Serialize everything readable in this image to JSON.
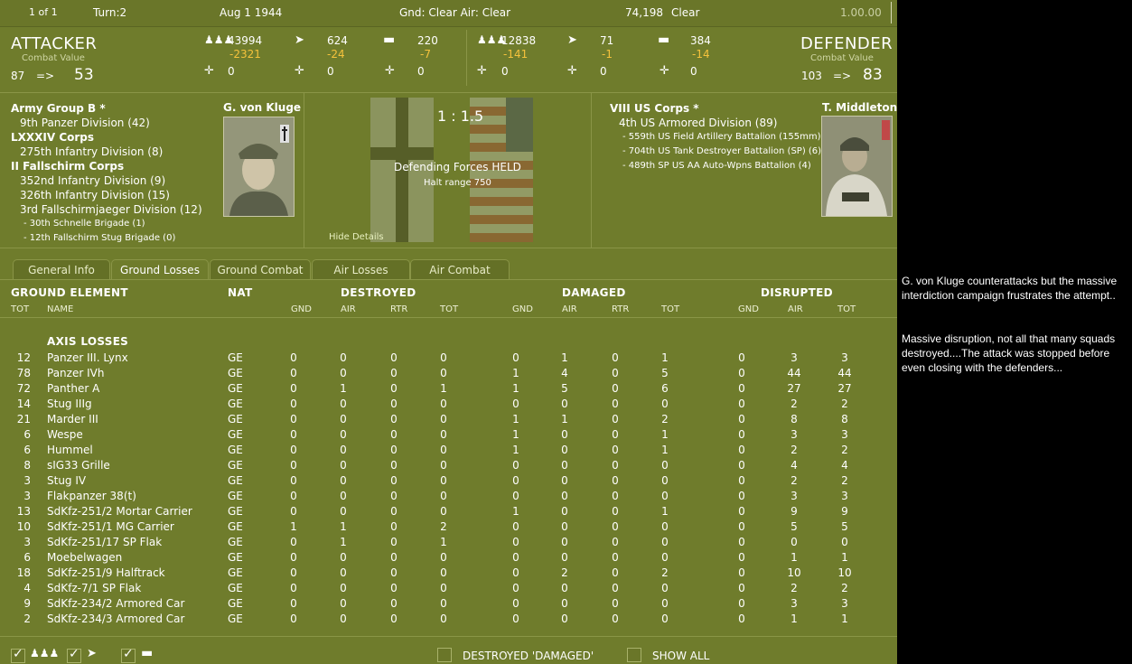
{
  "topbar": {
    "page": "1 of 1",
    "turn": "Turn:2",
    "date": "Aug 1 1944",
    "weather": "Gnd: Clear  Air: Clear",
    "counter": "74,198",
    "vis": "Clear",
    "zoom": "1.00.00"
  },
  "attacker": {
    "title": "ATTACKER",
    "cv_label": "Combat Value",
    "cv_from": "87",
    "arrow": "=>",
    "cv_to": "53",
    "men": "43994",
    "men_loss": "-2321",
    "air": "624",
    "air_loss": "-24",
    "tank": "220",
    "tank_loss": "-7",
    "r2a": "0",
    "r2b": "0",
    "r2c": "0",
    "leader": "G. von Kluge"
  },
  "defender": {
    "title": "DEFENDER",
    "cv_label": "Combat Value",
    "cv_from": "103",
    "arrow": "=>",
    "cv_to": "83",
    "men": "12838",
    "men_loss": "-141",
    "air": "71",
    "air_loss": "-1",
    "tank": "384",
    "tank_loss": "-14",
    "r2a": "0",
    "r2b": "0",
    "r2c": "0",
    "leader": "T. Middleton"
  },
  "center": {
    "odds": "1 : 1.5",
    "result": "Defending Forces HELD",
    "halt": "Halt range 750",
    "hide": "Hide Details"
  },
  "axis_oob": [
    {
      "t": "Army Group B  *",
      "cls": "hq"
    },
    {
      "t": "9th Panzer Division (42)",
      "cls": "div"
    },
    {
      "t": "LXXXIV Corps",
      "cls": "hq"
    },
    {
      "t": "275th Infantry Division (8)",
      "cls": "div"
    },
    {
      "t": "II Fallschirm Corps",
      "cls": "hq"
    },
    {
      "t": "352nd Infantry Division (9)",
      "cls": "div"
    },
    {
      "t": "326th Infantry Division (15)",
      "cls": "div"
    },
    {
      "t": "3rd Fallschirmjaeger Division (12)",
      "cls": "div"
    },
    {
      "t": "- 30th Schnelle Brigade (1)",
      "cls": "bde"
    },
    {
      "t": "- 12th Fallschirm Stug Brigade (0)",
      "cls": "bde"
    }
  ],
  "allied_oob": [
    {
      "t": "VIII US Corps  *",
      "cls": "hq"
    },
    {
      "t": "4th US Armored Division (89)",
      "cls": "div"
    },
    {
      "t": "- 559th US Field Artillery Battalion (155mm) (4)",
      "cls": "bde"
    },
    {
      "t": "- 704th US Tank Destroyer Battalion (SP) (6)",
      "cls": "bde"
    },
    {
      "t": "- 489th SP US AA Auto-Wpns Battalion (4)",
      "cls": "bde"
    }
  ],
  "tabs": [
    "General Info",
    "Ground Losses",
    "Ground Combat",
    "Air Losses",
    "Air Combat"
  ],
  "table": {
    "h_ground": "GROUND ELEMENT",
    "h_nat": "NAT",
    "h_destroyed": "DESTROYED",
    "h_damaged": "DAMAGED",
    "h_disrupted": "DISRUPTED",
    "s_tot": "TOT",
    "s_name": "NAME",
    "s_gnd": "GND",
    "s_air": "AIR",
    "s_rtr": "RTR",
    "s_tot2": "TOT",
    "section": "AXIS LOSSES",
    "rows": [
      [
        "12",
        "Panzer III. Lynx",
        "GE",
        "0",
        "0",
        "0",
        "0",
        "0",
        "1",
        "0",
        "1",
        "0",
        "3",
        "3"
      ],
      [
        "78",
        "Panzer IVh",
        "GE",
        "0",
        "0",
        "0",
        "0",
        "1",
        "4",
        "0",
        "5",
        "0",
        "44",
        "44"
      ],
      [
        "72",
        "Panther A",
        "GE",
        "0",
        "1",
        "0",
        "1",
        "1",
        "5",
        "0",
        "6",
        "0",
        "27",
        "27"
      ],
      [
        "14",
        "Stug IIIg",
        "GE",
        "0",
        "0",
        "0",
        "0",
        "0",
        "0",
        "0",
        "0",
        "0",
        "2",
        "2"
      ],
      [
        "21",
        "Marder III",
        "GE",
        "0",
        "0",
        "0",
        "0",
        "1",
        "1",
        "0",
        "2",
        "0",
        "8",
        "8"
      ],
      [
        "6",
        "Wespe",
        "GE",
        "0",
        "0",
        "0",
        "0",
        "1",
        "0",
        "0",
        "1",
        "0",
        "3",
        "3"
      ],
      [
        "6",
        "Hummel",
        "GE",
        "0",
        "0",
        "0",
        "0",
        "1",
        "0",
        "0",
        "1",
        "0",
        "2",
        "2"
      ],
      [
        "8",
        "sIG33 Grille",
        "GE",
        "0",
        "0",
        "0",
        "0",
        "0",
        "0",
        "0",
        "0",
        "0",
        "4",
        "4"
      ],
      [
        "3",
        "Stug IV",
        "GE",
        "0",
        "0",
        "0",
        "0",
        "0",
        "0",
        "0",
        "0",
        "0",
        "2",
        "2"
      ],
      [
        "3",
        "Flakpanzer 38(t)",
        "GE",
        "0",
        "0",
        "0",
        "0",
        "0",
        "0",
        "0",
        "0",
        "0",
        "3",
        "3"
      ],
      [
        "13",
        "SdKfz-251/2 Mortar Carrier",
        "GE",
        "0",
        "0",
        "0",
        "0",
        "1",
        "0",
        "0",
        "1",
        "0",
        "9",
        "9"
      ],
      [
        "10",
        "SdKfz-251/1 MG Carrier",
        "GE",
        "1",
        "1",
        "0",
        "2",
        "0",
        "0",
        "0",
        "0",
        "0",
        "5",
        "5"
      ],
      [
        "3",
        "SdKfz-251/17 SP Flak",
        "GE",
        "0",
        "1",
        "0",
        "1",
        "0",
        "0",
        "0",
        "0",
        "0",
        "0",
        "0"
      ],
      [
        "6",
        "Moebelwagen",
        "GE",
        "0",
        "0",
        "0",
        "0",
        "0",
        "0",
        "0",
        "0",
        "0",
        "1",
        "1"
      ],
      [
        "18",
        "SdKfz-251/9 Halftrack",
        "GE",
        "0",
        "0",
        "0",
        "0",
        "0",
        "2",
        "0",
        "2",
        "0",
        "10",
        "10"
      ],
      [
        "4",
        "SdKfz-7/1 SP Flak",
        "GE",
        "0",
        "0",
        "0",
        "0",
        "0",
        "0",
        "0",
        "0",
        "0",
        "2",
        "2"
      ],
      [
        "9",
        "SdKfz-234/2 Armored Car",
        "GE",
        "0",
        "0",
        "0",
        "0",
        "0",
        "0",
        "0",
        "0",
        "0",
        "3",
        "3"
      ],
      [
        "2",
        "SdKfz-234/3 Armored Car",
        "GE",
        "0",
        "0",
        "0",
        "0",
        "0",
        "0",
        "0",
        "0",
        "0",
        "1",
        "1"
      ]
    ]
  },
  "bottom": {
    "destroyed_damaged": "DESTROYED 'DAMAGED'",
    "show_all": "SHOW ALL"
  },
  "commentary": {
    "p1": "G. von Kluge counterattacks but the massive interdiction campaign frustrates the attempt..",
    "p2": "Massive disruption, not all that many squads destroyed....The attack was stopped before even closing with the defenders..."
  },
  "colors": {
    "panel": "#6f7c2c",
    "loss": "#f5c23c"
  }
}
